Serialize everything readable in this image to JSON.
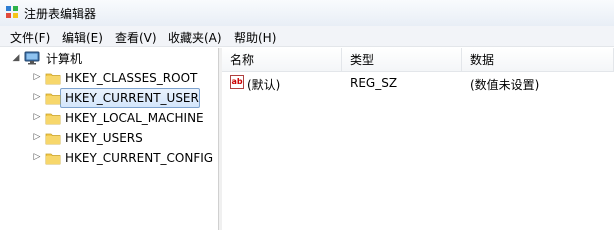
{
  "window": {
    "title": "注册表编辑器"
  },
  "menu": [
    "文件(F)",
    "编辑(E)",
    "查看(V)",
    "收藏夹(A)",
    "帮助(H)"
  ],
  "tree": {
    "root": "计算机",
    "children": [
      {
        "label": "HKEY_CLASSES_ROOT"
      },
      {
        "label": "HKEY_CURRENT_USER",
        "selected": true
      },
      {
        "label": "HKEY_LOCAL_MACHINE"
      },
      {
        "label": "HKEY_USERS"
      },
      {
        "label": "HKEY_CURRENT_CONFIG"
      }
    ]
  },
  "list": {
    "columns": [
      "名称",
      "类型",
      "数据"
    ],
    "rows": [
      {
        "name": "(默认)",
        "type": "REG_SZ",
        "data": "(数值未设置)",
        "icon": "string-value-icon"
      }
    ]
  },
  "colors": {
    "selection_border": "#7da2ce",
    "selection_fill": "#d4e6fb",
    "folder": "#f2c94c"
  }
}
